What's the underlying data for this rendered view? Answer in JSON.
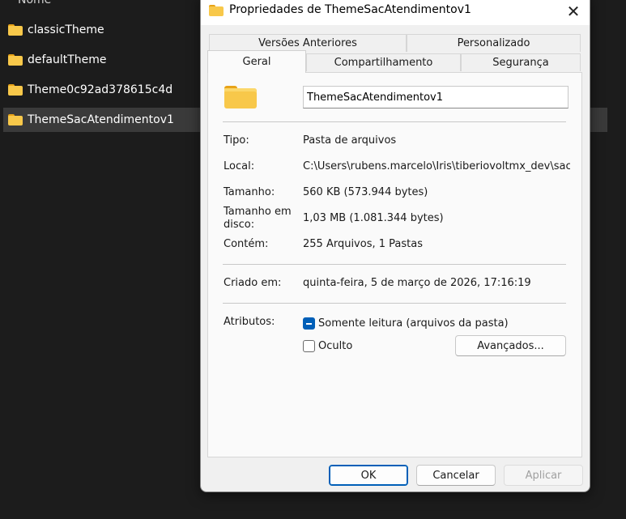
{
  "explorer": {
    "column_header": "Nome",
    "items": [
      {
        "name": "classicTheme"
      },
      {
        "name": "defaultTheme"
      },
      {
        "name": "Theme0c92ad378615c4d"
      },
      {
        "name": "ThemeSacAtendimentov1"
      }
    ],
    "selected_index": 3
  },
  "dialog": {
    "title": "Propriedades de ThemeSacAtendimentov1",
    "title_icon": "folder-icon",
    "close_icon": "close-icon",
    "tabs_row1": [
      {
        "label": "Versões Anteriores"
      },
      {
        "label": "Personalizado"
      }
    ],
    "tabs_row2": [
      {
        "label": "Geral"
      },
      {
        "label": "Compartilhamento"
      },
      {
        "label": "Segurança"
      }
    ],
    "active_tab": "Geral",
    "folder_name": "ThemeSacAtendimentov1",
    "info": {
      "tipo_label": "Tipo:",
      "tipo_value": "Pasta de arquivos",
      "local_label": "Local:",
      "local_value": "C:\\Users\\rubens.marcelo\\Iris\\tiberiovoltmx_dev\\sacAter",
      "tamanho_label": "Tamanho:",
      "tamanho_value": "560 KB (573.944 bytes)",
      "tamanho_disco_label": "Tamanho em disco:",
      "tamanho_disco_value": "1,03 MB (1.081.344 bytes)",
      "contem_label": "Contém:",
      "contem_value": "255 Arquivos, 1 Pastas",
      "criado_label": "Criado em:",
      "criado_value": "quinta-feira, 5 de março de 2026, 17:16:19",
      "atributos_label": "Atributos:"
    },
    "attributes": {
      "somente_leitura_label": "Somente leitura (arquivos da pasta)",
      "oculto_label": "Oculto",
      "avancados_label": "Avançados..."
    },
    "buttons": {
      "ok": "OK",
      "cancelar": "Cancelar",
      "aplicar": "Aplicar"
    },
    "colors": {
      "accent": "#005fb8",
      "folder": "#f8c84a"
    }
  }
}
